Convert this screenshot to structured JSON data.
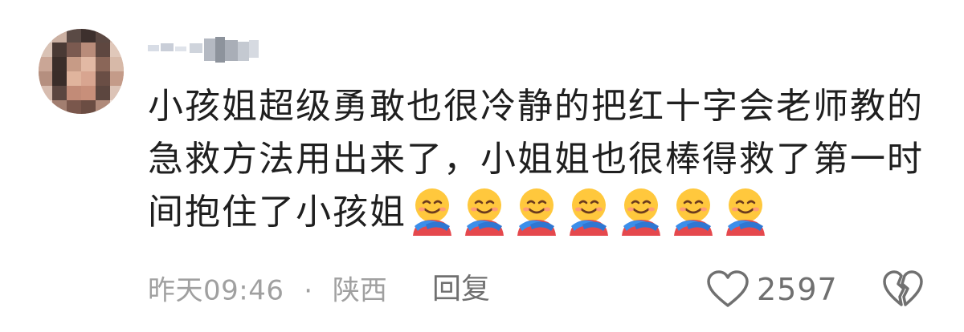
{
  "comment": {
    "username": "",
    "body_lines": [
      "小孩姐超级勇敢也很冷静的把红十字会老师教的",
      "急救方法用出来了，小姐姐也很棒得救了第一时",
      "间抱住了小孩姐"
    ],
    "emojis": [
      "hugging-face-icon",
      "hugging-face-icon",
      "hugging-face-icon",
      "hugging-face-icon",
      "hugging-face-icon",
      "hugging-face-icon",
      "hugging-face-icon"
    ],
    "time": "昨天09:46",
    "separator": "·",
    "location": "陕西",
    "reply_label": "回复",
    "like_count": "2597",
    "colors": {
      "text": "#1f1f1f",
      "meta": "#a0a0a0",
      "icon": "#707070"
    }
  }
}
